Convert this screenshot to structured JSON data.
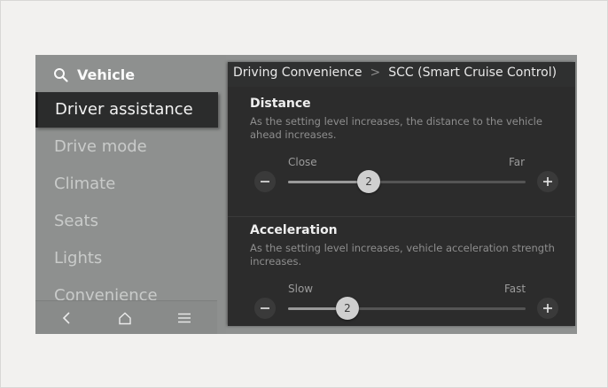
{
  "sidebar": {
    "search_label": "Vehicle",
    "items": [
      {
        "label": "Driver assistance",
        "active": true
      },
      {
        "label": "Drive mode"
      },
      {
        "label": "Climate"
      },
      {
        "label": "Seats"
      },
      {
        "label": "Lights"
      },
      {
        "label": "Convenience"
      }
    ]
  },
  "bottom_nav": {
    "back_icon": "back-icon",
    "home_icon": "home-icon",
    "menu_icon": "menu-icon"
  },
  "breadcrumb": {
    "parent": "Driving Convenience",
    "separator": ">",
    "current": "SCC (Smart Cruise Control)"
  },
  "distance": {
    "title": "Distance",
    "description": "As the setting level increases, the distance to the vehicle ahead increases.",
    "min_label": "Close",
    "max_label": "Far",
    "value": "2",
    "fraction": 0.34
  },
  "acceleration": {
    "title": "Acceleration",
    "description": "As the setting level increases, vehicle acceleration strength increases.",
    "min_label": "Slow",
    "max_label": "Fast",
    "value": "2",
    "fraction": 0.25
  },
  "colors": {
    "panel": "#2c2c2c",
    "sidebar": "#8e908f",
    "active_item": "#2b2c2c"
  }
}
